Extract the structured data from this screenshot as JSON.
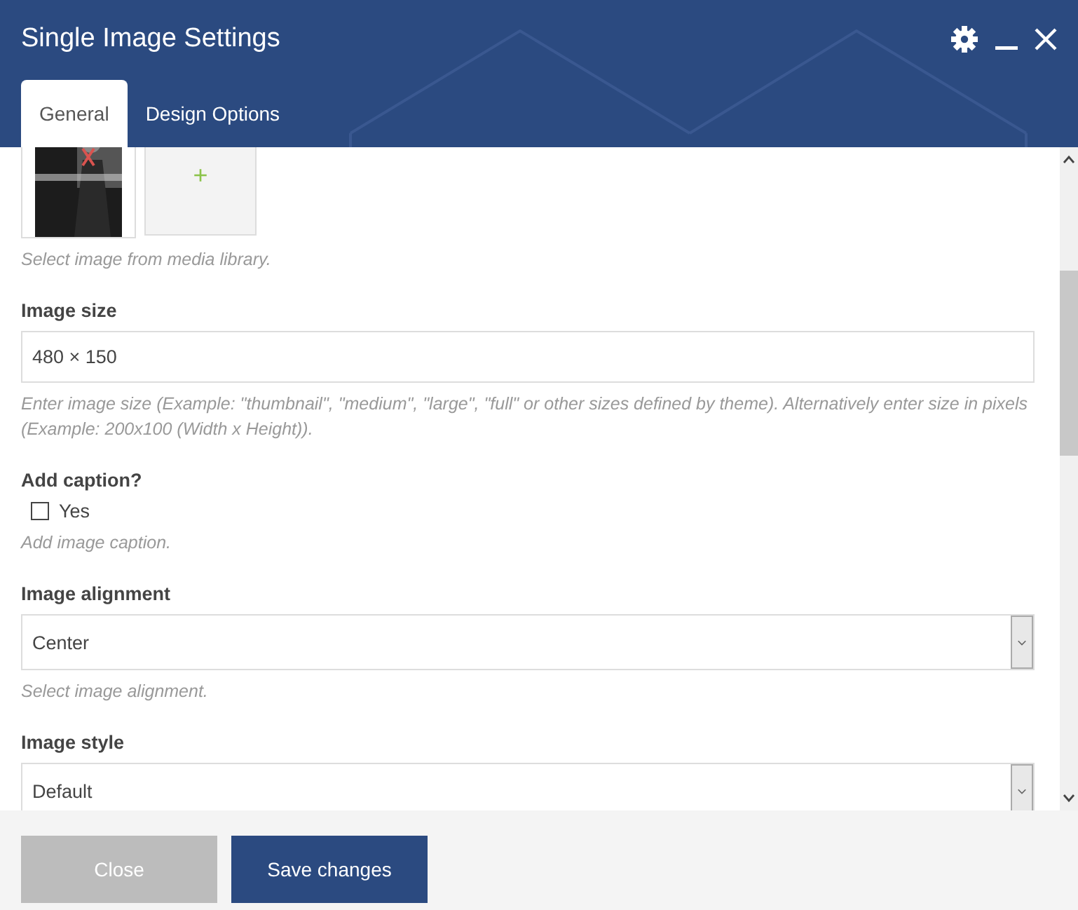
{
  "window": {
    "title": "Single Image Settings"
  },
  "tabs": [
    {
      "label": "General",
      "selected": true
    },
    {
      "label": "Design Options",
      "selected": false
    }
  ],
  "fields": [
    {
      "kind": "images",
      "add_label": "+",
      "help": "Select image from media library."
    },
    {
      "kind": "text",
      "label": "Image size",
      "value": "480 × 150",
      "help": "Enter image size (Example: \"thumbnail\", \"medium\", \"large\", \"full\" or other sizes defined by theme). Alternatively enter size in pixels (Example: 200x100 (Width x Height))."
    },
    {
      "kind": "checkbox",
      "label": "Add caption?",
      "option": "Yes",
      "checked": false,
      "help": "Add image caption."
    },
    {
      "kind": "select",
      "label": "Image alignment",
      "value": "Center",
      "help": "Select image alignment."
    },
    {
      "kind": "select",
      "label": "Image style",
      "value": "Default"
    }
  ],
  "buttons": [
    {
      "label": "Close",
      "kind": "secondary"
    },
    {
      "label": "Save changes",
      "kind": "primary"
    }
  ]
}
